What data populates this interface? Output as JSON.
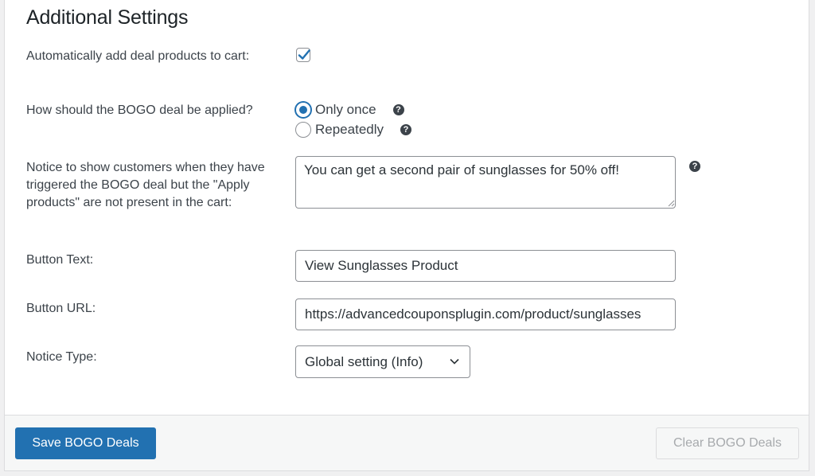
{
  "section": {
    "title": "Additional Settings"
  },
  "settings": {
    "auto_add": {
      "label": "Automatically add deal products to cart:",
      "checked": true
    },
    "apply_mode": {
      "label": "How should the BOGO deal be applied?",
      "options": [
        {
          "label": "Only once",
          "selected": true
        },
        {
          "label": "Repeatedly",
          "selected": false
        }
      ]
    },
    "notice": {
      "label": "Notice to show customers when they have triggered the BOGO deal but the \"Apply products\" are not present in the cart:",
      "value": "You can get a second pair of sunglasses for 50% off!"
    },
    "button_text": {
      "label": "Button Text:",
      "value": "View Sunglasses Product"
    },
    "button_url": {
      "label": "Button URL:",
      "value": "https://advancedcouponsplugin.com/product/sunglasses"
    },
    "notice_type": {
      "label": "Notice Type:",
      "selected": "Global setting (Info)"
    }
  },
  "help_symbol": "?",
  "footer": {
    "save_label": "Save BOGO Deals",
    "clear_label": "Clear BOGO Deals"
  },
  "colors": {
    "accent": "#2271b1",
    "help_icon": "#3c434a"
  },
  "icons": {
    "checkmark": "checkmark-icon",
    "help": "help-icon",
    "chevron": "chevron-down-icon",
    "resize": "resize-grip-icon"
  }
}
